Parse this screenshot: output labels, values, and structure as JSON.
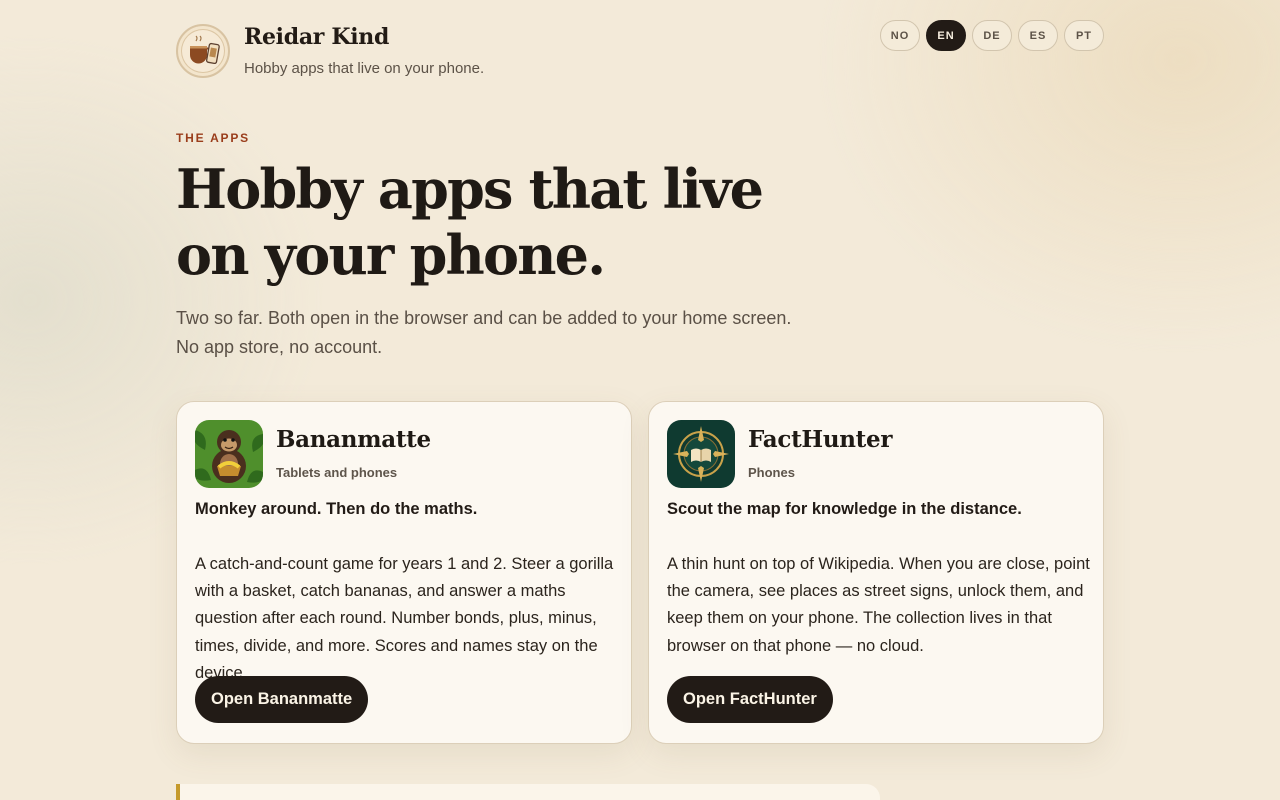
{
  "header": {
    "brand_name": "Reidar Kind",
    "brand_tagline": "Hobby apps that live on your phone.",
    "logo_icon": "coffee-cup-and-phone-icon",
    "languages": [
      {
        "code": "NO",
        "active": false
      },
      {
        "code": "EN",
        "active": true
      },
      {
        "code": "DE",
        "active": false
      },
      {
        "code": "ES",
        "active": false
      },
      {
        "code": "PT",
        "active": false
      }
    ]
  },
  "hero": {
    "eyebrow": "THE APPS",
    "title_line1": "Hobby apps that live",
    "title_line2": "on your phone.",
    "subtitle_line1": "Two so far. Both open in the browser and can be added to your home screen.",
    "subtitle_line2": "No app store, no account."
  },
  "apps": [
    {
      "name": "Bananmatte",
      "devices": "Tablets and phones",
      "icon": "gorilla-icon",
      "tagline": "Monkey around. Then do the maths.",
      "description": "A catch-and-count game for years 1 and 2. Steer a gorilla with a basket, catch bananas, and answer a maths question after each round. Number bonds, plus, minus, times, divide, and more. Scores and names stay on the device.",
      "button": "Open Bananmatte"
    },
    {
      "name": "FactHunter",
      "devices": "Phones",
      "icon": "compass-book-icon",
      "tagline": "Scout the map for knowledge in the distance.",
      "description": "A thin hunt on top of Wikipedia. When you are close, point the camera, see places as street signs, unlock them, and keep them on your phone. The collection lives in that browser on that phone — no cloud.",
      "button": "Open FactHunter"
    }
  ],
  "colors": {
    "background": "#f3ead9",
    "accent": "#9a3d1b",
    "dark": "#221b16",
    "card": "#fcf8f1"
  }
}
